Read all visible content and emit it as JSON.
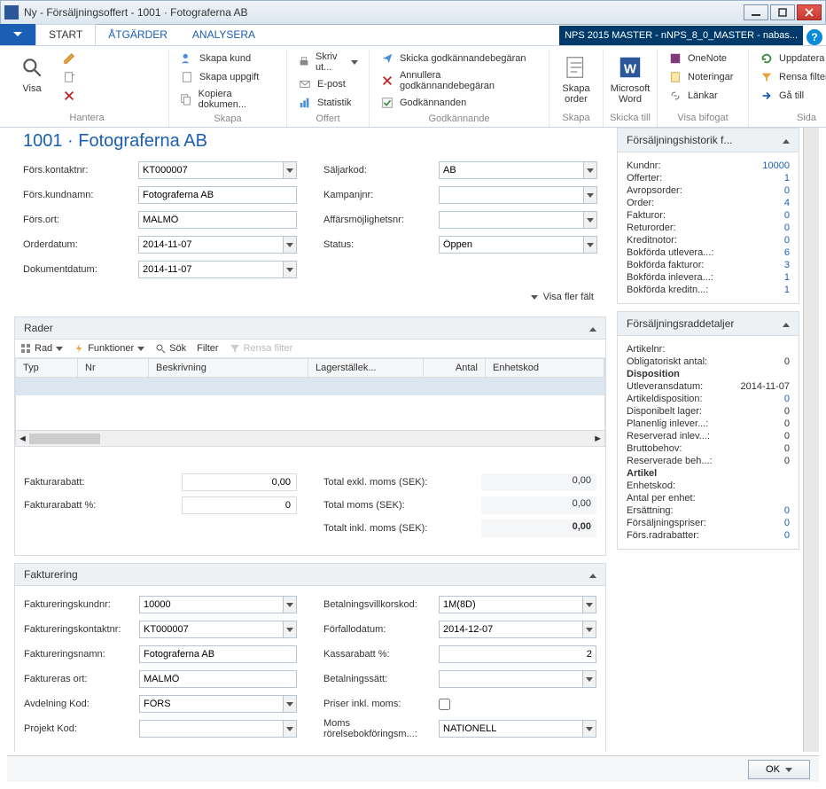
{
  "window": {
    "title": "Ny - Försäljningsoffert - 1001 · Fotograferna AB"
  },
  "breadcrumb": "NPS 2015 MASTER - nNPS_8_0_MASTER - nabas...",
  "tabs": {
    "start": "START",
    "atgarder": "ÅTGÄRDER",
    "analysera": "ANALYSERA"
  },
  "ribbon": {
    "hantera": {
      "visa": "Visa",
      "group": "Hantera"
    },
    "skapa": {
      "skapa_kund": "Skapa kund",
      "skapa_uppgift": "Skapa uppgift",
      "kopiera_dokument": "Kopiera dokumen...",
      "group": "Skapa"
    },
    "offert": {
      "skriv_ut": "Skriv ut...",
      "epost": "E-post",
      "statistik": "Statistik",
      "group": "Offert"
    },
    "godkannande": {
      "skicka": "Skicka godkännandebegäran",
      "annullera": "Annullera godkännandebegäran",
      "godkannanden": "Godkännanden",
      "group": "Godkännande"
    },
    "skapa2": {
      "skapa_order": "Skapa order",
      "group": "Skapa"
    },
    "skicka_till": {
      "word": "Microsoft Word",
      "group": "Skicka till"
    },
    "visa_bifogat": {
      "onenote": "OneNote",
      "noteringar": "Noteringar",
      "lankar": "Länkar",
      "group": "Visa bifogat"
    },
    "sida": {
      "uppdatera": "Uppdatera",
      "rensa_filter": "Rensa filter",
      "ga_till": "Gå till",
      "group": "Sida"
    }
  },
  "page_title": "1001 · Fotograferna AB",
  "general": {
    "left": {
      "fors_kontaktnr": {
        "label": "Förs.kontaktnr:",
        "value": "KT000007"
      },
      "fors_kundnamn": {
        "label": "Förs.kundnamn:",
        "value": "Fotograferna AB"
      },
      "fors_ort": {
        "label": "Förs.ort:",
        "value": "MALMÖ"
      },
      "orderdatum": {
        "label": "Orderdatum:",
        "value": "2014-11-07"
      },
      "dokumentdatum": {
        "label": "Dokumentdatum:",
        "value": "2014-11-07"
      }
    },
    "right": {
      "saljarkod": {
        "label": "Säljarkod:",
        "value": "AB"
      },
      "kampanjnr": {
        "label": "Kampanjnr:",
        "value": ""
      },
      "affarsmojlighetsnr": {
        "label": "Affärsmöjlighetsnr:",
        "value": ""
      },
      "status": {
        "label": "Status:",
        "value": "Öppen"
      }
    },
    "more": "Visa fler fält"
  },
  "rader": {
    "title": "Rader",
    "toolbar": {
      "rad": "Rad",
      "funktioner": "Funktioner",
      "sok": "Sök",
      "filter": "Filter",
      "rensa": "Rensa filter"
    },
    "columns": {
      "typ": "Typ",
      "nr": "Nr",
      "beskrivning": "Beskrivning",
      "lagerstallek": "Lagerställek...",
      "antal": "Antal",
      "enhetskod": "Enhetskod"
    }
  },
  "totals": {
    "fakturarabatt": {
      "label": "Fakturarabatt:",
      "value": "0,00"
    },
    "fakturarabatt_pct": {
      "label": "Fakturarabatt %:",
      "value": "0"
    },
    "total_exkl": {
      "label": "Total exkl. moms (SEK):",
      "value": "0,00"
    },
    "total_moms": {
      "label": "Total moms (SEK):",
      "value": "0,00"
    },
    "total_inkl": {
      "label": "Totalt inkl. moms (SEK):",
      "value": "0,00"
    }
  },
  "fakturering": {
    "title": "Fakturering",
    "left": {
      "kundnr": {
        "label": "Faktureringskundnr:",
        "value": "10000"
      },
      "kontaktnr": {
        "label": "Faktureringskontaktnr:",
        "value": "KT000007"
      },
      "namn": {
        "label": "Faktureringsnamn:",
        "value": "Fotograferna AB"
      },
      "ort": {
        "label": "Faktureras ort:",
        "value": "MALMÖ"
      },
      "avdelning": {
        "label": "Avdelning Kod:",
        "value": "FÖRS"
      },
      "projekt": {
        "label": "Projekt Kod:",
        "value": ""
      }
    },
    "right": {
      "betvillkor": {
        "label": "Betalningsvillkorskod:",
        "value": "1M(8D)"
      },
      "forfallo": {
        "label": "Förfallodatum:",
        "value": "2014-12-07"
      },
      "kassarabatt": {
        "label": "Kassarabatt %:",
        "value": "2"
      },
      "betsatt": {
        "label": "Betalningssätt:",
        "value": ""
      },
      "priser_inkl": {
        "label": "Priser inkl. moms:"
      },
      "moms_rorelse": {
        "label": "Moms rörelsebokföringsm...:",
        "value": "NATIONELL"
      }
    }
  },
  "side": {
    "historik": {
      "title": "Försäljningshistorik f...",
      "rows": [
        {
          "label": "Kundnr:",
          "value": "10000"
        },
        {
          "label": "Offerter:",
          "value": "1"
        },
        {
          "label": "Avropsorder:",
          "value": "0"
        },
        {
          "label": "Order:",
          "value": "4"
        },
        {
          "label": "Fakturor:",
          "value": "0"
        },
        {
          "label": "Returorder:",
          "value": "0"
        },
        {
          "label": "Kreditnotor:",
          "value": "0"
        },
        {
          "label": "Bokförda utlevera...:",
          "value": "6"
        },
        {
          "label": "Bokförda fakturor:",
          "value": "3"
        },
        {
          "label": "Bokförda inlevera...:",
          "value": "1"
        },
        {
          "label": "Bokförda kreditn...:",
          "value": "1"
        }
      ]
    },
    "raddetaljer": {
      "title": "Försäljningsraddetaljer",
      "artikelnr": {
        "label": "Artikelnr:",
        "value": ""
      },
      "obligatoriskt": {
        "label": "Obligatoriskt antal:",
        "value": "0"
      },
      "disposition_header": "Disposition",
      "utleveransdatum": {
        "label": "Utleveransdatum:",
        "value": "2014-11-07"
      },
      "artikeldisposition": {
        "label": "Artikeldisposition:",
        "value": "0"
      },
      "disponibelt": {
        "label": "Disponibelt lager:",
        "value": "0"
      },
      "planenlig": {
        "label": "Planenlig inlever...:",
        "value": "0"
      },
      "reserverad_inlev": {
        "label": "Reserverad inlev...:",
        "value": "0"
      },
      "bruttobehov": {
        "label": "Bruttobehov:",
        "value": "0"
      },
      "reserverade_beh": {
        "label": "Reserverade beh...:",
        "value": "0"
      },
      "artikel_header": "Artikel",
      "enhetskod": {
        "label": "Enhetskod:",
        "value": ""
      },
      "antal_per_enhet": {
        "label": "Antal per enhet:",
        "value": ""
      },
      "ersattning": {
        "label": "Ersättning:",
        "value": "0"
      },
      "forsaljningspriser": {
        "label": "Försäljningspriser:",
        "value": "0"
      },
      "fors_radrabatter": {
        "label": "Förs.radrabatter:",
        "value": "0"
      }
    }
  },
  "ok": "OK"
}
